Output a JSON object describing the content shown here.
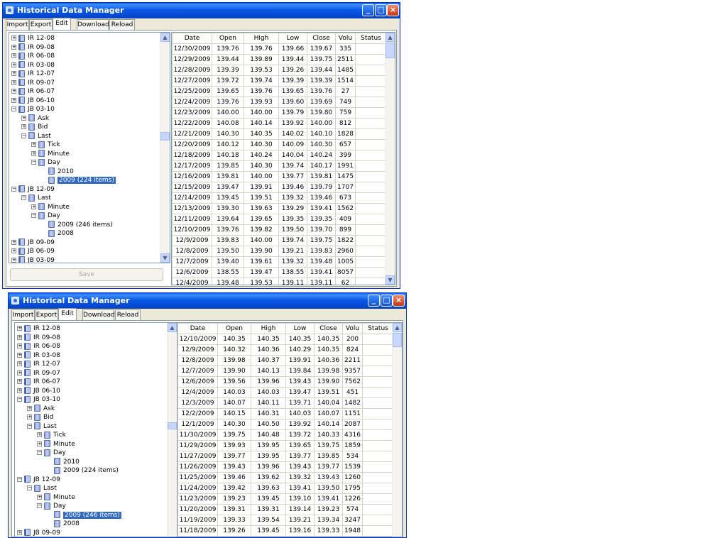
{
  "window1": {
    "title": "Historical Data Manager",
    "tabs": [
      "Import",
      "Export",
      "Edit",
      "Download",
      "Reload"
    ],
    "active_tab": "Edit",
    "save_label": "Save",
    "columns": [
      "Date",
      "Open",
      "High",
      "Low",
      "Close",
      "Volu",
      "Status"
    ],
    "tree": [
      {
        "label": "IR 12-08",
        "depth": 0,
        "exp": "+",
        "icon": "book"
      },
      {
        "label": "IR 09-08",
        "depth": 0,
        "exp": "+",
        "icon": "book"
      },
      {
        "label": "IR 06-08",
        "depth": 0,
        "exp": "+",
        "icon": "book"
      },
      {
        "label": "IR 03-08",
        "depth": 0,
        "exp": "+",
        "icon": "book"
      },
      {
        "label": "IR 12-07",
        "depth": 0,
        "exp": "+",
        "icon": "book"
      },
      {
        "label": "IR 09-07",
        "depth": 0,
        "exp": "+",
        "icon": "book"
      },
      {
        "label": "IR 06-07",
        "depth": 0,
        "exp": "+",
        "icon": "book"
      },
      {
        "label": "JB 06-10",
        "depth": 0,
        "exp": "+",
        "icon": "book"
      },
      {
        "label": "JB 03-10",
        "depth": 0,
        "exp": "-",
        "icon": "book"
      },
      {
        "label": "Ask",
        "depth": 1,
        "exp": "+",
        "icon": "db"
      },
      {
        "label": "Bid",
        "depth": 1,
        "exp": "+",
        "icon": "db"
      },
      {
        "label": "Last",
        "depth": 1,
        "exp": "-",
        "icon": "db"
      },
      {
        "label": "Tick",
        "depth": 2,
        "exp": "+",
        "icon": "db"
      },
      {
        "label": "Minute",
        "depth": 2,
        "exp": "+",
        "icon": "db"
      },
      {
        "label": "Day",
        "depth": 2,
        "exp": "-",
        "icon": "db"
      },
      {
        "label": "2010",
        "depth": 3,
        "exp": "",
        "icon": "db"
      },
      {
        "label": "2009 (224 items)",
        "depth": 3,
        "exp": "",
        "icon": "db",
        "selected": true
      },
      {
        "label": "JB 12-09",
        "depth": 0,
        "exp": "-",
        "icon": "book"
      },
      {
        "label": "Last",
        "depth": 1,
        "exp": "-",
        "icon": "db"
      },
      {
        "label": "Minute",
        "depth": 2,
        "exp": "+",
        "icon": "db"
      },
      {
        "label": "Day",
        "depth": 2,
        "exp": "-",
        "icon": "db"
      },
      {
        "label": "2009 (246 items)",
        "depth": 3,
        "exp": "",
        "icon": "db"
      },
      {
        "label": "2008",
        "depth": 3,
        "exp": "",
        "icon": "db"
      },
      {
        "label": "JB 09-09",
        "depth": 0,
        "exp": "+",
        "icon": "book"
      },
      {
        "label": "JB 06-09",
        "depth": 0,
        "exp": "+",
        "icon": "book"
      },
      {
        "label": "JB 03-09",
        "depth": 0,
        "exp": "+",
        "icon": "book"
      }
    ],
    "rows": [
      [
        "12/30/2009",
        "139.76",
        "139.76",
        "139.66",
        "139.67",
        "335",
        ""
      ],
      [
        "12/29/2009",
        "139.44",
        "139.89",
        "139.44",
        "139.75",
        "2511",
        ""
      ],
      [
        "12/28/2009",
        "139.39",
        "139.53",
        "139.26",
        "139.44",
        "1485",
        ""
      ],
      [
        "12/27/2009",
        "139.72",
        "139.74",
        "139.39",
        "139.39",
        "1514",
        ""
      ],
      [
        "12/25/2009",
        "139.65",
        "139.76",
        "139.65",
        "139.76",
        "27",
        ""
      ],
      [
        "12/24/2009",
        "139.76",
        "139.93",
        "139.60",
        "139.69",
        "749",
        ""
      ],
      [
        "12/23/2009",
        "140.00",
        "140.00",
        "139.79",
        "139.80",
        "759",
        ""
      ],
      [
        "12/22/2009",
        "140.08",
        "140.14",
        "139.92",
        "140.00",
        "812",
        ""
      ],
      [
        "12/21/2009",
        "140.30",
        "140.35",
        "140.02",
        "140.10",
        "1828",
        ""
      ],
      [
        "12/20/2009",
        "140.12",
        "140.30",
        "140.09",
        "140.30",
        "657",
        ""
      ],
      [
        "12/18/2009",
        "140.18",
        "140.24",
        "140.04",
        "140.24",
        "399",
        ""
      ],
      [
        "12/17/2009",
        "139.85",
        "140.30",
        "139.74",
        "140.17",
        "1991",
        ""
      ],
      [
        "12/16/2009",
        "139.81",
        "140.00",
        "139.77",
        "139.81",
        "1475",
        ""
      ],
      [
        "12/15/2009",
        "139.47",
        "139.91",
        "139.46",
        "139.79",
        "1707",
        ""
      ],
      [
        "12/14/2009",
        "139.45",
        "139.51",
        "139.32",
        "139.46",
        "673",
        ""
      ],
      [
        "12/13/2009",
        "139.30",
        "139.63",
        "139.29",
        "139.41",
        "1562",
        ""
      ],
      [
        "12/11/2009",
        "139.64",
        "139.65",
        "139.35",
        "139.35",
        "409",
        ""
      ],
      [
        "12/10/2009",
        "139.76",
        "139.82",
        "139.50",
        "139.70",
        "899",
        ""
      ],
      [
        "12/9/2009",
        "139.83",
        "140.00",
        "139.74",
        "139.75",
        "1822",
        ""
      ],
      [
        "12/8/2009",
        "139.50",
        "139.90",
        "139.21",
        "139.83",
        "2960",
        ""
      ],
      [
        "12/7/2009",
        "139.40",
        "139.61",
        "139.32",
        "139.48",
        "1005",
        ""
      ],
      [
        "12/6/2009",
        "138.55",
        "139.47",
        "138.55",
        "139.41",
        "8057",
        ""
      ],
      [
        "12/4/2009",
        "139.48",
        "139.53",
        "139.11",
        "139.11",
        "62",
        ""
      ]
    ]
  },
  "window2": {
    "title": "Historical Data Manager",
    "tabs": [
      "Import",
      "Export",
      "Edit",
      "Download",
      "Reload"
    ],
    "active_tab": "Edit",
    "columns": [
      "Date",
      "Open",
      "High",
      "Low",
      "Close",
      "Volu",
      "Status"
    ],
    "tree": [
      {
        "label": "IR 12-08",
        "depth": 0,
        "exp": "+",
        "icon": "book"
      },
      {
        "label": "IR 09-08",
        "depth": 0,
        "exp": "+",
        "icon": "book"
      },
      {
        "label": "IR 06-08",
        "depth": 0,
        "exp": "+",
        "icon": "book"
      },
      {
        "label": "IR 03-08",
        "depth": 0,
        "exp": "+",
        "icon": "book"
      },
      {
        "label": "IR 12-07",
        "depth": 0,
        "exp": "+",
        "icon": "book"
      },
      {
        "label": "IR 09-07",
        "depth": 0,
        "exp": "+",
        "icon": "book"
      },
      {
        "label": "IR 06-07",
        "depth": 0,
        "exp": "+",
        "icon": "book"
      },
      {
        "label": "JB 06-10",
        "depth": 0,
        "exp": "+",
        "icon": "book"
      },
      {
        "label": "JB 03-10",
        "depth": 0,
        "exp": "-",
        "icon": "book"
      },
      {
        "label": "Ask",
        "depth": 1,
        "exp": "+",
        "icon": "db"
      },
      {
        "label": "Bid",
        "depth": 1,
        "exp": "+",
        "icon": "db"
      },
      {
        "label": "Last",
        "depth": 1,
        "exp": "-",
        "icon": "db"
      },
      {
        "label": "Tick",
        "depth": 2,
        "exp": "+",
        "icon": "db"
      },
      {
        "label": "Minute",
        "depth": 2,
        "exp": "+",
        "icon": "db"
      },
      {
        "label": "Day",
        "depth": 2,
        "exp": "-",
        "icon": "db"
      },
      {
        "label": "2010",
        "depth": 3,
        "exp": "",
        "icon": "db"
      },
      {
        "label": "2009 (224 items)",
        "depth": 3,
        "exp": "",
        "icon": "db"
      },
      {
        "label": "JB 12-09",
        "depth": 0,
        "exp": "-",
        "icon": "book"
      },
      {
        "label": "Last",
        "depth": 1,
        "exp": "-",
        "icon": "db"
      },
      {
        "label": "Minute",
        "depth": 2,
        "exp": "+",
        "icon": "db"
      },
      {
        "label": "Day",
        "depth": 2,
        "exp": "-",
        "icon": "db"
      },
      {
        "label": "2009 (246 items)",
        "depth": 3,
        "exp": "",
        "icon": "db",
        "selected": true
      },
      {
        "label": "2008",
        "depth": 3,
        "exp": "",
        "icon": "db"
      },
      {
        "label": "JB 09-09",
        "depth": 0,
        "exp": "+",
        "icon": "book"
      }
    ],
    "rows": [
      [
        "12/10/2009",
        "140.35",
        "140.35",
        "140.35",
        "140.35",
        "200",
        ""
      ],
      [
        "12/9/2009",
        "140.32",
        "140.36",
        "140.29",
        "140.35",
        "824",
        ""
      ],
      [
        "12/8/2009",
        "139.98",
        "140.37",
        "139.91",
        "140.36",
        "2211",
        ""
      ],
      [
        "12/7/2009",
        "139.90",
        "140.13",
        "139.84",
        "139.98",
        "9357",
        ""
      ],
      [
        "12/6/2009",
        "139.56",
        "139.96",
        "139.43",
        "139.90",
        "7562",
        ""
      ],
      [
        "12/4/2009",
        "140.03",
        "140.03",
        "139.47",
        "139.51",
        "451",
        ""
      ],
      [
        "12/3/2009",
        "140.07",
        "140.11",
        "139.71",
        "140.04",
        "1482",
        ""
      ],
      [
        "12/2/2009",
        "140.15",
        "140.31",
        "140.03",
        "140.07",
        "1151",
        ""
      ],
      [
        "12/1/2009",
        "140.30",
        "140.50",
        "139.92",
        "140.14",
        "2087",
        ""
      ],
      [
        "11/30/2009",
        "139.75",
        "140.48",
        "139.72",
        "140.33",
        "4316",
        ""
      ],
      [
        "11/29/2009",
        "139.93",
        "139.95",
        "139.65",
        "139.75",
        "1859",
        ""
      ],
      [
        "11/27/2009",
        "139.77",
        "139.95",
        "139.77",
        "139.85",
        "534",
        ""
      ],
      [
        "11/26/2009",
        "139.43",
        "139.96",
        "139.43",
        "139.77",
        "1539",
        ""
      ],
      [
        "11/25/2009",
        "139.46",
        "139.62",
        "139.32",
        "139.43",
        "1260",
        ""
      ],
      [
        "11/24/2009",
        "139.42",
        "139.63",
        "139.41",
        "139.50",
        "1795",
        ""
      ],
      [
        "11/23/2009",
        "139.23",
        "139.45",
        "139.10",
        "139.41",
        "1226",
        ""
      ],
      [
        "11/20/2009",
        "139.31",
        "139.31",
        "139.14",
        "139.23",
        "574",
        ""
      ],
      [
        "11/19/2009",
        "139.33",
        "139.54",
        "139.21",
        "139.34",
        "3247",
        ""
      ],
      [
        "11/18/2009",
        "139.26",
        "139.45",
        "139.16",
        "139.33",
        "1948",
        ""
      ]
    ]
  }
}
